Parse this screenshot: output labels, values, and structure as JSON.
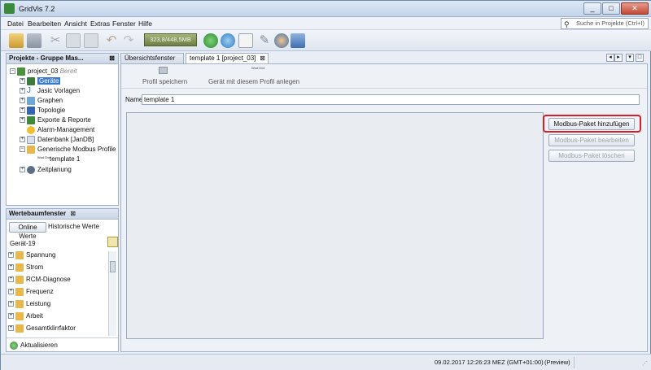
{
  "window": {
    "title": "GridVis 7.2",
    "min_label": "_",
    "max_label": "□",
    "close_label": "✕"
  },
  "menu": [
    "Datei",
    "Bearbeiten",
    "Ansicht",
    "Extras",
    "Fenster",
    "Hilfe"
  ],
  "search": {
    "placeholder": "Suche in Projekte (Ctrl+I)"
  },
  "toolbar": {
    "memory": "323,8/448,5MB"
  },
  "projects_panel": {
    "title": "Projekte - Gruppe Mas...",
    "root": {
      "name": "project_03",
      "status": "Bereit"
    },
    "items": [
      {
        "label": "Geräte",
        "selected": true
      },
      {
        "label": "Jasic Vorlagen"
      },
      {
        "label": "Graphen"
      },
      {
        "label": "Topologie"
      },
      {
        "label": "Exporte & Reporte"
      },
      {
        "label": "Alarm-Management"
      },
      {
        "label": "Datenbank [JanDB]"
      },
      {
        "label": "Generische Modbus Profile"
      },
      {
        "label": "template 1"
      },
      {
        "label": "Zeitplanung"
      }
    ]
  },
  "values_panel": {
    "title": "Wertebaumfenster",
    "tab_online": "Online Werte",
    "tab_historic": "Historische Werte",
    "device": "Gerät-19",
    "items": [
      "Spannung",
      "Strom",
      "RCM-Diagnose",
      "Frequenz",
      "Leistung",
      "Arbeit",
      "Gesamtklirrfaktor"
    ],
    "refresh": "Aktualisieren"
  },
  "tabs": [
    {
      "label": "Übersichtsfenster"
    },
    {
      "label": "template 1 [project_03]"
    }
  ],
  "editor": {
    "save_profile": "Profil speichern",
    "create_device": "Gerät mit diesem Profil anlegen",
    "wod_icon_text": "Wod Dvd",
    "name_label": "Name",
    "name_value": "template 1",
    "add_packet": "Modbus-Paket hinzufügen",
    "edit_packet": "Modbus-Paket bearbeiten",
    "delete_packet": "Modbus-Paket löschen"
  },
  "status": {
    "datetime": "09.02.2017 12:26:23 MEZ (GMT+01:00)",
    "preview": "(Preview)"
  },
  "colors": {
    "highlight": "#d2202b",
    "selection": "#3a78c8"
  }
}
